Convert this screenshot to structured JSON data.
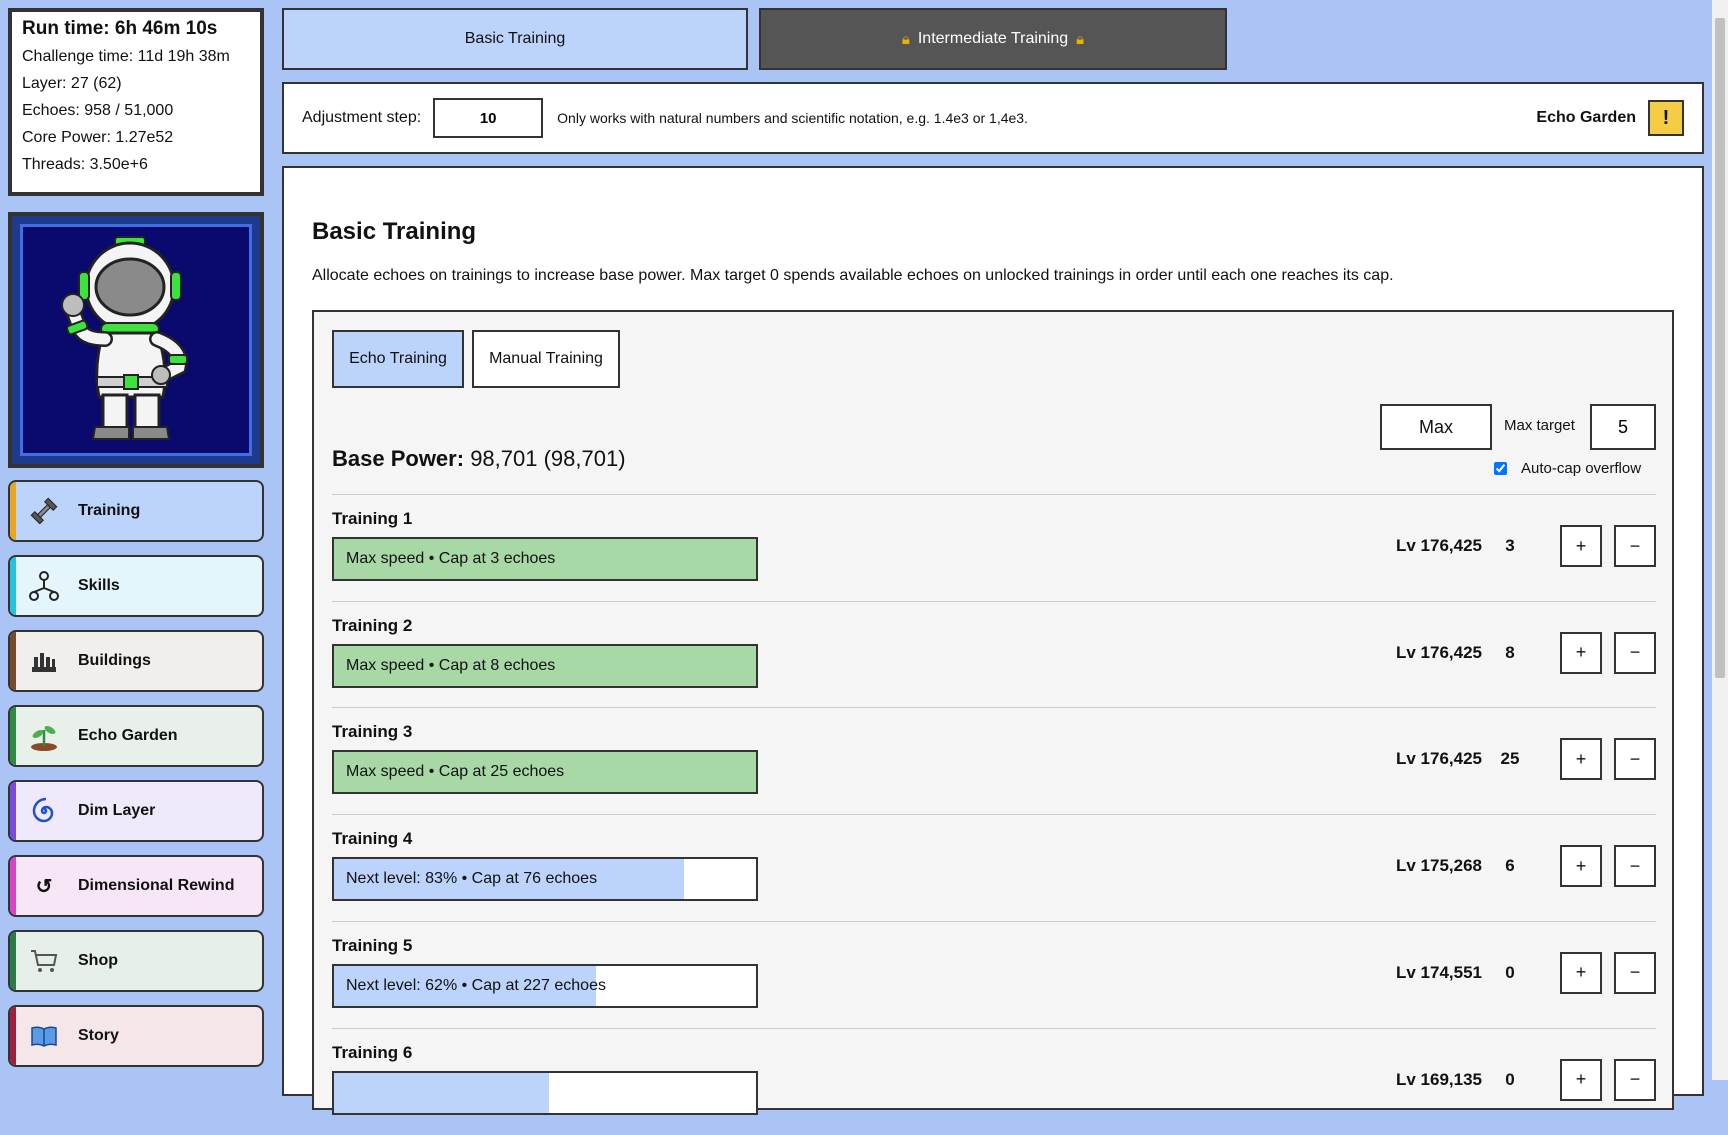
{
  "stats": {
    "run_time": "Run time: 6h 46m 10s",
    "challenge_time": "Challenge time: 11d 19h 38m",
    "layer": "Layer: 27 (62)",
    "echoes": "Echoes: 958 / 51,000",
    "core_power": "Core Power: 1.27e52",
    "threads": "Threads: 3.50e+6"
  },
  "nav": [
    {
      "label": "Training",
      "icon": "dumbbell-icon",
      "bg": "#bcd3fb",
      "stripe": "#e8a626"
    },
    {
      "label": "Skills",
      "icon": "skills-tree-icon",
      "bg": "#e4f6fb",
      "stripe": "#27c3d8"
    },
    {
      "label": "Buildings",
      "icon": "buildings-icon",
      "bg": "#f2eeec",
      "stripe": "#7a4a2c"
    },
    {
      "label": "Echo Garden",
      "icon": "sprout-icon",
      "bg": "#e9f0ea",
      "stripe": "#2f8a44"
    },
    {
      "label": "Dim Layer",
      "icon": "spiral-icon",
      "bg": "#efe9fb",
      "stripe": "#7b4ad8"
    },
    {
      "label": "Dimensional Rewind",
      "icon": "rewind-icon",
      "bg": "#f7e6f6",
      "stripe": "#d744c6"
    },
    {
      "label": "Shop",
      "icon": "cart-icon",
      "bg": "#e6efe8",
      "stripe": "#2c7a47"
    },
    {
      "label": "Story",
      "icon": "book-icon",
      "bg": "#f5e6ea",
      "stripe": "#a02040"
    }
  ],
  "tabs": {
    "basic": "Basic Training",
    "intermediate": "Intermediate Training"
  },
  "adjust": {
    "label": "Adjustment step:",
    "value": "10",
    "hint": "Only works with natural numbers and scientific notation, e.g. 1.4e3 or 1,4e3.",
    "garden_label": "Echo Garden",
    "warn": "!"
  },
  "main": {
    "title": "Basic Training",
    "description": "Allocate echoes on trainings to increase base power. Max target 0 spends available echoes on unlocked trainings in order until each one reaches its cap.",
    "subtabs": {
      "echo": "Echo Training",
      "manual": "Manual Training"
    },
    "max_button": "Max",
    "max_target_label": "Max target",
    "max_target_value": "5",
    "autocap_label": "Auto-cap overflow",
    "autocap_checked": true,
    "base_power_label": "Base Power:",
    "base_power_value": "98,701 (98,701)"
  },
  "trainings": [
    {
      "name": "Training 1",
      "bar_text": "Max speed • Cap at 3 echoes",
      "progress": 1.0,
      "bar_color": "#a7d8a6",
      "level": "Lv 176,425",
      "allocated": "3"
    },
    {
      "name": "Training 2",
      "bar_text": "Max speed • Cap at 8 echoes",
      "progress": 1.0,
      "bar_color": "#a7d8a6",
      "level": "Lv 176,425",
      "allocated": "8"
    },
    {
      "name": "Training 3",
      "bar_text": "Max speed • Cap at 25 echoes",
      "progress": 1.0,
      "bar_color": "#a7d8a6",
      "level": "Lv 176,425",
      "allocated": "25"
    },
    {
      "name": "Training 4",
      "bar_text": "Next level: 83% • Cap at 76 echoes",
      "progress": 0.83,
      "bar_color": "#bcd3fb",
      "level": "Lv 175,268",
      "allocated": "6"
    },
    {
      "name": "Training 5",
      "bar_text": "Next level: 62% • Cap at 227 echoes",
      "progress": 0.62,
      "bar_color": "#bcd3fb",
      "level": "Lv 174,551",
      "allocated": "0"
    },
    {
      "name": "Training 6",
      "bar_text": "",
      "progress": 0.51,
      "bar_color": "#bcd3fb",
      "level": "Lv 169,135",
      "allocated": "0"
    }
  ],
  "buttons": {
    "plus": "+",
    "minus": "−"
  }
}
